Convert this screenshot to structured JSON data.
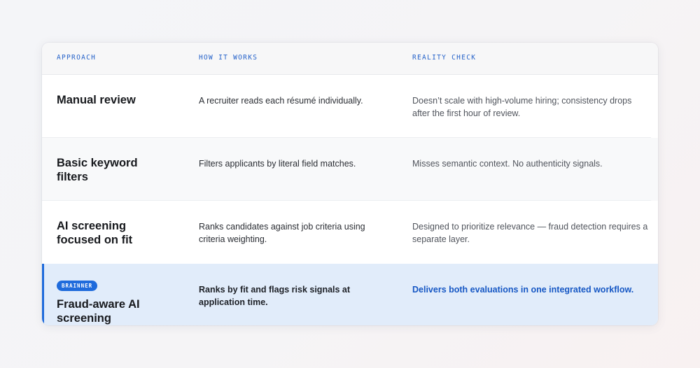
{
  "table": {
    "headers": {
      "approach": "APPROACH",
      "how": "HOW IT WORKS",
      "reality": "REALITY CHECK"
    },
    "rows": [
      {
        "approach": "Manual review",
        "how": "A recruiter reads each résumé individually.",
        "reality": "Doesn’t scale with high-volume hiring; consistency drops after the first hour of review."
      },
      {
        "approach": "Basic keyword filters",
        "how": "Filters applicants by literal field matches.",
        "reality": "Misses semantic context. No authenticity signals."
      },
      {
        "approach": "AI screening focused on fit",
        "how": "Ranks candidates against job criteria using criteria weighting.",
        "reality": "Designed to prioritize relevance — fraud detection requires a separate layer."
      },
      {
        "badge": "BRAINNER",
        "approach": "Fraud-aware AI screening",
        "how": "Ranks by fit and flags risk signals at application time.",
        "reality": "Delivers both evaluations in one integrated workflow."
      }
    ]
  },
  "colors": {
    "accent": "#1f6bdc",
    "highlight_bg": "#e1ecfa",
    "header_text": "#2461c9"
  }
}
